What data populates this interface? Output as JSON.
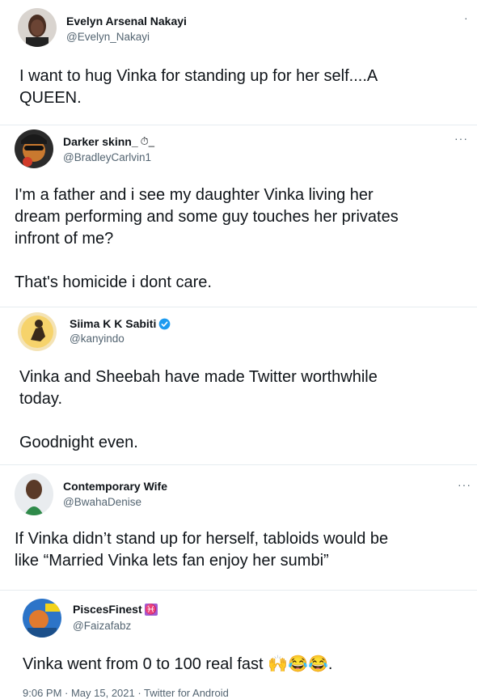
{
  "tweets": [
    {
      "name": "Evelyn Arsenal Nakayi",
      "handle": "@Evelyn_Nakayi",
      "more": "·",
      "text": "I want to hug Vinka for standing up for her self....A\nQUEEN."
    },
    {
      "name": "Darker skinn_",
      "name_suffix": "⏱_",
      "handle": "@BradleyCarlvin1",
      "more": "···",
      "text": "I'm a father and i see my daughter Vinka living her\ndream performing and some guy touches her privates\ninfront of me?\n\nThat's homicide i dont care."
    },
    {
      "name": "Siima K K Sabiti",
      "verified": true,
      "handle": "@kanyindo",
      "text": "Vinka and Sheebah have made Twitter worthwhile\ntoday.\n\nGoodnight even."
    },
    {
      "name": "Contemporary Wife",
      "handle": "@BwahaDenise",
      "more": "···",
      "text": "If Vinka didn’t stand up for herself, tabloids would be\nlike “Married Vinka lets fan enjoy her sumbi”"
    },
    {
      "name": "PiscesFinest",
      "name_emoji": "♓",
      "handle": "@Faizafabz",
      "text": "Vinka went from 0 to 100 real fast",
      "text_emojis": "🙌😂😂",
      "text_end": "."
    }
  ],
  "footer": "9:06 PM · May 15, 2021 · Twitter for Android",
  "icons": {
    "verified": "verified-badge-icon",
    "more": "more-options-icon"
  },
  "colors": {
    "text": "#0f1419",
    "secondary": "#536471",
    "verified": "#1d9bf0",
    "divider": "#e6ecf0"
  }
}
